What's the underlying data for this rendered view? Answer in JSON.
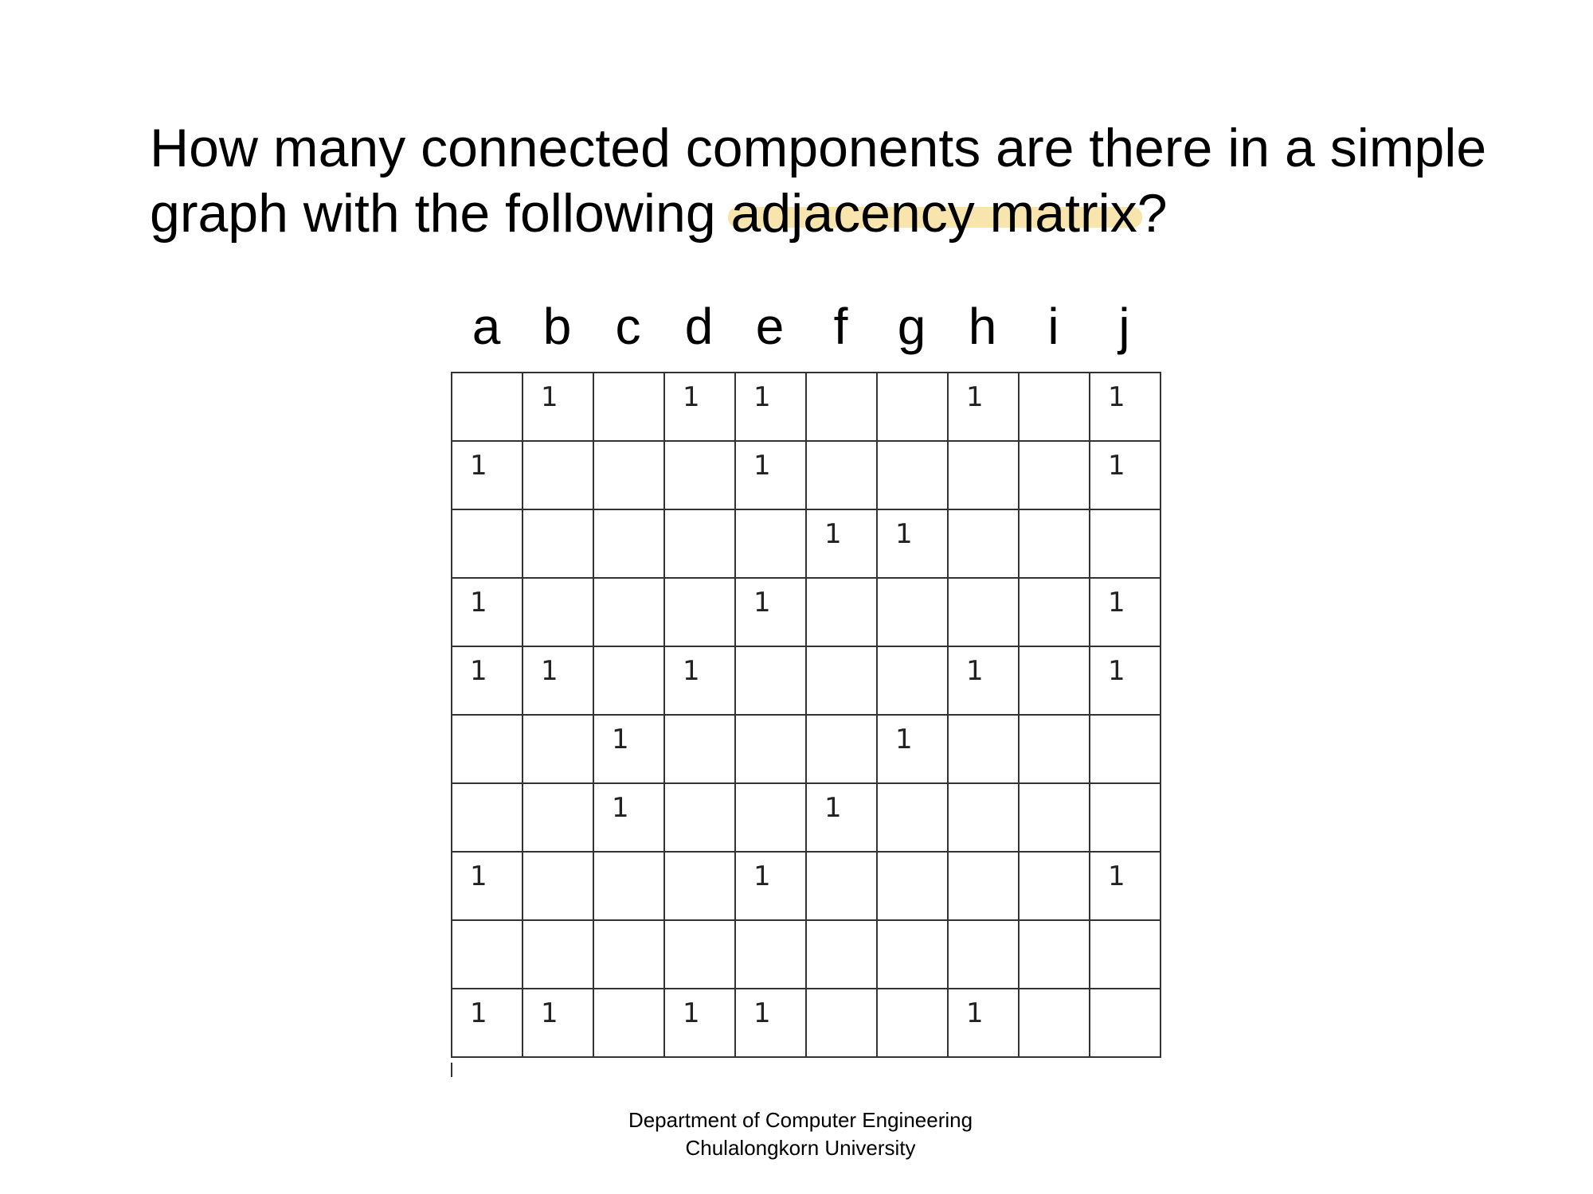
{
  "question": {
    "line1": "How many connected components are there in a simple",
    "line2_prefix": "graph with the following ",
    "line2_highlight": "adjacency matrix",
    "line2_suffix": "?"
  },
  "highlight_color": "#f6e2a4",
  "matrix": {
    "column_labels": [
      "a",
      "b",
      "c",
      "d",
      "e",
      "f",
      "g",
      "h",
      "i",
      "j"
    ],
    "rows": [
      [
        "",
        "1",
        "",
        "1",
        "1",
        "",
        "",
        "1",
        "",
        "1"
      ],
      [
        "1",
        "",
        "",
        "",
        "1",
        "",
        "",
        "",
        "",
        "1"
      ],
      [
        "",
        "",
        "",
        "",
        "",
        "1",
        "1",
        "",
        "",
        ""
      ],
      [
        "1",
        "",
        "",
        "",
        "1",
        "",
        "",
        "",
        "",
        "1"
      ],
      [
        "1",
        "1",
        "",
        "1",
        "",
        "",
        "",
        "1",
        "",
        "1"
      ],
      [
        "",
        "",
        "1",
        "",
        "",
        "",
        "1",
        "",
        "",
        ""
      ],
      [
        "",
        "",
        "1",
        "",
        "",
        "1",
        "",
        "",
        "",
        ""
      ],
      [
        "1",
        "",
        "",
        "",
        "1",
        "",
        "",
        "",
        "",
        "1"
      ],
      [
        "",
        "",
        "",
        "",
        "",
        "",
        "",
        "",
        "",
        ""
      ],
      [
        "1",
        "1",
        "",
        "1",
        "1",
        "",
        "",
        "1",
        "",
        ""
      ]
    ]
  },
  "footer": {
    "line1": "Department of Computer Engineering",
    "line2": "Chulalongkorn University"
  }
}
